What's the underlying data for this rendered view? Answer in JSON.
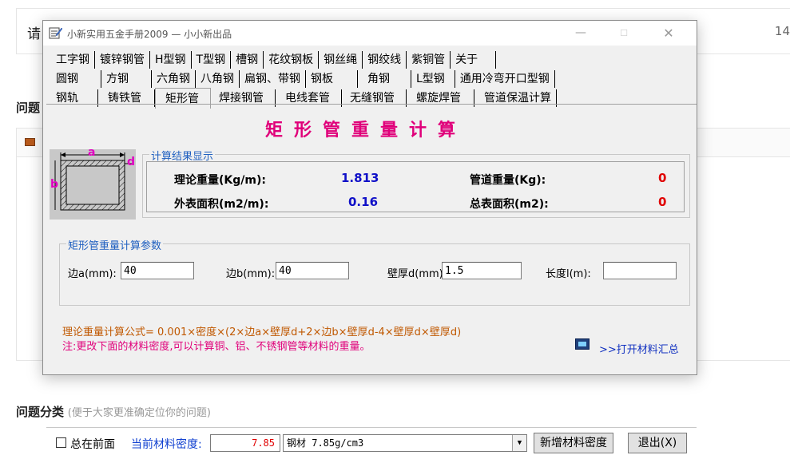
{
  "background": {
    "prompt_char": "请",
    "count": "14",
    "heading": "问题",
    "category_title": "问题分类",
    "category_hint": "(便于大家更准确定位你的问题)"
  },
  "window": {
    "title": "小新实用五金手册2009 — 小小新出品",
    "min_glyph": "—",
    "max_glyph": "☐",
    "close_glyph": "✕"
  },
  "tabs": {
    "row1": [
      "工字钢",
      "镀锌钢管",
      "H型钢",
      "T型钢",
      "槽钢",
      "花纹钢板",
      "钢丝绳",
      "钢绞线",
      "紫铜管",
      "关于"
    ],
    "row2": [
      "圆钢",
      "方钢",
      "六角钢",
      "八角钢",
      "扁钢、带钢",
      "钢板",
      "角钢",
      "L型钢",
      "通用冷弯开口型钢"
    ],
    "row3": [
      "钢轨",
      "铸铁管",
      "矩形管",
      "焊接钢管",
      "电线套管",
      "无缝钢管",
      "螺旋焊管",
      "管道保温计算"
    ],
    "active": "矩形管"
  },
  "calc": {
    "title": "矩形管重量计算",
    "diagram_labels": {
      "a": "a",
      "b": "b",
      "d": "d"
    }
  },
  "results": {
    "legend": "计算结果显示",
    "theory_weight_label": "理论重量(Kg/m):",
    "theory_weight_value": "1.813",
    "pipe_weight_label": "管道重量(Kg):",
    "pipe_weight_value": "0",
    "outer_area_label": "外表面积(m2/m):",
    "outer_area_value": "0.16",
    "total_area_label": "总表面积(m2):",
    "total_area_value": "0"
  },
  "params": {
    "legend": "矩形管重量计算参数",
    "side_a_label": "边a(mm):",
    "side_a_value": "40",
    "side_b_label": "边b(mm):",
    "side_b_value": "40",
    "thickness_label": "壁厚d(mm)",
    "thickness_value": "1.5",
    "length_label": "长度l(m):",
    "length_value": ""
  },
  "formula": "理论重量计算公式= 0.001×密度×(2×边a×壁厚d+2×边b×壁厚d-4×壁厚d×壁厚d)",
  "note": "注:更改下面的材料密度,可以计算铜、铝、不锈钢管等材料的重量。",
  "open_summary": ">>打开材料汇总",
  "bottom": {
    "always_on_top_label": "总在前面",
    "density_label": "当前材料密度:",
    "density_value": "7.85",
    "material_value": "钢材 7.85g/cm3",
    "add_density_button": "新增材料密度",
    "exit_button": "退出(X)"
  },
  "colors": {
    "title_magenta": "#e0007a",
    "value_blue": "#1010c8",
    "value_red": "#e00000",
    "formula_orange": "#c05800",
    "legend_blue": "#2060c0"
  }
}
